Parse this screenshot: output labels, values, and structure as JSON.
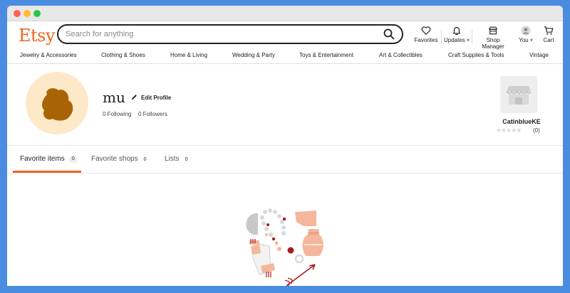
{
  "header": {
    "logo": "Etsy",
    "search_placeholder": "Search for anything",
    "nav": {
      "favorites": "Favorites",
      "updates": "Updates",
      "shop_manager": "Shop Manager",
      "you": "You",
      "cart": "Cart"
    }
  },
  "categories": [
    "Jewelry & Accessories",
    "Clothing & Shoes",
    "Home & Living",
    "Wedding & Party",
    "Toys & Entertainment",
    "Art & Collectibles",
    "Craft Supplies & Tools",
    "Vintage"
  ],
  "profile": {
    "username": "mu",
    "edit_label": "Edit Profile",
    "following": "0 Following",
    "followers": "0 Followers",
    "avatar_color": "#a86404",
    "avatar_bg": "#fde8c8"
  },
  "shop": {
    "name": "CatinblueKE",
    "stars": "★★★★★",
    "reviews": "(0)"
  },
  "tabs": [
    {
      "label": "Favorite items",
      "count": "0"
    },
    {
      "label": "Favorite shops",
      "count": "0"
    },
    {
      "label": "Lists",
      "count": "0"
    }
  ],
  "colors": {
    "accent": "#f1641e",
    "background": "#4a8de0"
  }
}
